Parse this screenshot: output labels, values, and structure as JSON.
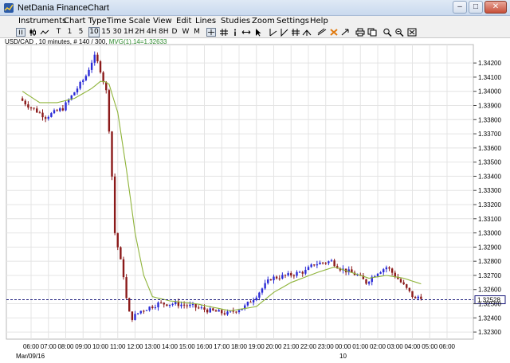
{
  "window": {
    "title": "NetDania FinanceChart",
    "minimize": "–",
    "maximize": "□",
    "close": "✕"
  },
  "menu": [
    "Instruments",
    "Chart Type",
    "Time Scale",
    "View",
    "Edit",
    "Lines",
    "Studies",
    "Zoom",
    "Settings",
    "Help"
  ],
  "toolbar": {
    "intervals": [
      "T",
      "1",
      "5",
      "10",
      "15",
      "30",
      "1H",
      "2H",
      "4H",
      "8H",
      "D",
      "W",
      "M"
    ],
    "active_interval": "10",
    "icons": [
      "bar-chart-icon",
      "candlestick-chart-icon",
      "line-chart-icon",
      "crosshair-icon",
      "grid-icon",
      "info-icon",
      "pan-icon",
      "cursor-icon",
      "trendline-icon",
      "fibonacci-icon",
      "arrow-icon",
      "channel-icon",
      "delete-icon",
      "pointer-icon",
      "print-icon",
      "copy-icon",
      "zoom-in-icon",
      "zoom-out-icon",
      "zoom-fit-icon"
    ]
  },
  "chart_header": {
    "symbol": "USD/CAD , 10 minutes, # 140 / 300,",
    "mvg": "MVG(1).14=1.32633"
  },
  "chart_data": {
    "type": "candlestick",
    "instrument": "USD/CAD",
    "interval": "10 minutes",
    "current_price": "1.32528",
    "moving_average": {
      "name": "MVG(1).14",
      "value": 1.32633,
      "color": "#8fb43a"
    },
    "up_color": "#2b2bd6",
    "down_color": "#8b1a1a",
    "ylim": [
      1.3225,
      1.3433
    ],
    "y_ticks": [
      "1.32300",
      "1.32400",
      "1.32500",
      "1.32600",
      "1.32700",
      "1.32800",
      "1.32900",
      "1.33000",
      "1.33100",
      "1.33200",
      "1.33300",
      "1.33400",
      "1.33500",
      "1.33600",
      "1.33700",
      "1.33800",
      "1.33900",
      "1.34000",
      "1.34100",
      "1.34200"
    ],
    "x_ticks": [
      "06:00",
      "07:00",
      "08:00",
      "09:00",
      "10:00",
      "11:00",
      "12:00",
      "13:00",
      "14:00",
      "15:00",
      "16:00",
      "17:00",
      "18:00",
      "19:00",
      "20:00",
      "21:00",
      "22:00",
      "23:00",
      "00:00",
      "01:00",
      "02:00",
      "03:00",
      "04:00",
      "05:00",
      "06:00"
    ],
    "date_labels": [
      "Mar/09/16",
      "10"
    ],
    "hours_start": 5.5,
    "hours_end": 30.5,
    "anchors": [
      [
        0.0,
        1.3395
      ],
      [
        0.5,
        1.339
      ],
      [
        1.5,
        1.3382
      ],
      [
        2.5,
        1.3388
      ],
      [
        3.2,
        1.34
      ],
      [
        3.8,
        1.341
      ],
      [
        4.3,
        1.3425
      ],
      [
        4.6,
        1.3418
      ],
      [
        5.0,
        1.34
      ],
      [
        5.25,
        1.336
      ],
      [
        5.5,
        1.33
      ],
      [
        5.75,
        1.3285
      ],
      [
        6.0,
        1.327
      ],
      [
        6.25,
        1.3245
      ],
      [
        6.5,
        1.324
      ],
      [
        7.0,
        1.3245
      ],
      [
        8.0,
        1.325
      ],
      [
        9.0,
        1.325
      ],
      [
        10.0,
        1.3248
      ],
      [
        11.0,
        1.3245
      ],
      [
        12.0,
        1.3243
      ],
      [
        13.0,
        1.3248
      ],
      [
        13.6,
        1.3255
      ],
      [
        14.5,
        1.3268
      ],
      [
        15.5,
        1.327
      ],
      [
        16.5,
        1.3273
      ],
      [
        17.0,
        1.3278
      ],
      [
        18.0,
        1.328
      ],
      [
        18.5,
        1.3275
      ],
      [
        19.5,
        1.327
      ],
      [
        20.0,
        1.3265
      ],
      [
        20.6,
        1.3272
      ],
      [
        21.2,
        1.3276
      ],
      [
        21.8,
        1.3268
      ],
      [
        22.5,
        1.3258
      ],
      [
        22.9,
        1.3252
      ],
      [
        23.0,
        1.3255
      ]
    ],
    "ma_anchors": [
      [
        0.0,
        1.34
      ],
      [
        1.0,
        1.3392
      ],
      [
        2.0,
        1.3392
      ],
      [
        3.0,
        1.3395
      ],
      [
        4.0,
        1.3402
      ],
      [
        4.6,
        1.3408
      ],
      [
        5.0,
        1.3405
      ],
      [
        5.5,
        1.3385
      ],
      [
        6.0,
        1.3345
      ],
      [
        6.5,
        1.33
      ],
      [
        7.0,
        1.327
      ],
      [
        7.5,
        1.3255
      ],
      [
        8.5,
        1.3252
      ],
      [
        10.0,
        1.325
      ],
      [
        12.0,
        1.3245
      ],
      [
        13.5,
        1.3248
      ],
      [
        14.5,
        1.3258
      ],
      [
        15.5,
        1.3265
      ],
      [
        17.0,
        1.3272
      ],
      [
        18.0,
        1.3276
      ],
      [
        19.0,
        1.3272
      ],
      [
        20.0,
        1.3268
      ],
      [
        21.0,
        1.327
      ],
      [
        22.0,
        1.3268
      ],
      [
        23.0,
        1.3264
      ]
    ]
  }
}
